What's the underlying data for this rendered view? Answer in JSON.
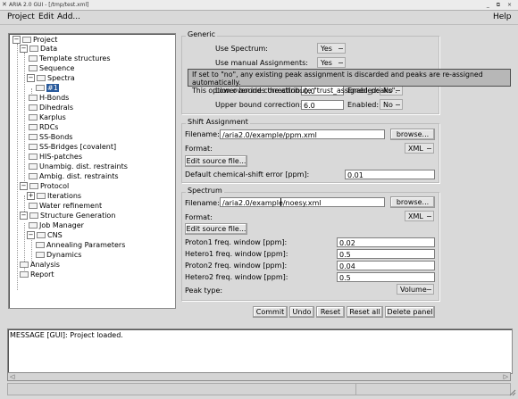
{
  "window": {
    "title": "ARIA 2.0 GUI - [/tmp/test.xml]",
    "controls": "_ ⧉ ×"
  },
  "menu": {
    "project": "Project",
    "edit": "Edit",
    "add": "Add...",
    "help": "Help"
  },
  "tree": {
    "root": "Project",
    "data": "Data",
    "template_structures": "Template structures",
    "sequence": "Sequence",
    "spectra": "Spectra",
    "spectrum_1": "#1",
    "hbonds": "H-Bonds",
    "dihedrals": "Dihedrals",
    "karplus": "Karplus",
    "rdcs": "RDCs",
    "ss_bonds": "SS-Bonds",
    "ss_bridges": "SS-Bridges [covalent]",
    "his_patches": "HIS-patches",
    "unambig": "Unambig. dist. restraints",
    "ambig": "Ambig. dist. restraints",
    "protocol": "Protocol",
    "iterations": "Iterations",
    "water_refinement": "Water refinement",
    "structure_generation": "Structure Generation",
    "job_manager": "Job Manager",
    "cns": "CNS",
    "annealing": "Annealing Parameters",
    "dynamics": "Dynamics",
    "analysis": "Analysis",
    "report": "Report"
  },
  "generic": {
    "title": "Generic",
    "use_spectrum_label": "Use Spectrum:",
    "use_spectrum_value": "Yes",
    "use_manual_label": "Use manual Assignments:",
    "use_manual_value": "Yes",
    "tooltip_line1": "If set to \"no\", any existing peak assignment is discarded and peaks are re-assigned automatically.",
    "tooltip_line2": "This option overrides the attribute \"trust_assigned_peaks\".",
    "lower_label": "Lower bound correction:",
    "lower_value": "0.0",
    "enabled_label": "Enabled:",
    "lower_enabled": "No",
    "upper_label": "Upper bound correction:",
    "upper_value": "6.0",
    "upper_enabled": "No"
  },
  "shift": {
    "title": "Shift Assignment",
    "filename_label": "Filename:",
    "filename_value": "/aria2.0/example/ppm.xml",
    "browse": "browse...",
    "format_label": "Format:",
    "format_value": "XML",
    "edit_source": "Edit source file...",
    "error_label": "Default chemical-shift error [ppm]:",
    "error_value": "0.01"
  },
  "spectrum": {
    "title": "Spectrum",
    "filename_label": "Filename:",
    "filename_value": "/aria2.0/example/noesy.xml",
    "browse": "browse...",
    "format_label": "Format:",
    "format_value": "XML",
    "edit_source": "Edit source file...",
    "proton1_label": "Proton1 freq. window [ppm]:",
    "proton1_value": "0.02",
    "hetero1_label": "Hetero1 freq. window [ppm]:",
    "hetero1_value": "0.5",
    "proton2_label": "Proton2 freq. window [ppm]:",
    "proton2_value": "0.04",
    "hetero2_label": "Hetero2 freq. window [ppm]:",
    "hetero2_value": "0.5",
    "peak_type_label": "Peak type:",
    "peak_type_value": "Volume"
  },
  "actions": {
    "commit": "Commit",
    "undo": "Undo",
    "reset": "Reset",
    "reset_all": "Reset all",
    "delete_panel": "Delete panel"
  },
  "message": "MESSAGE [GUI]: Project loaded."
}
